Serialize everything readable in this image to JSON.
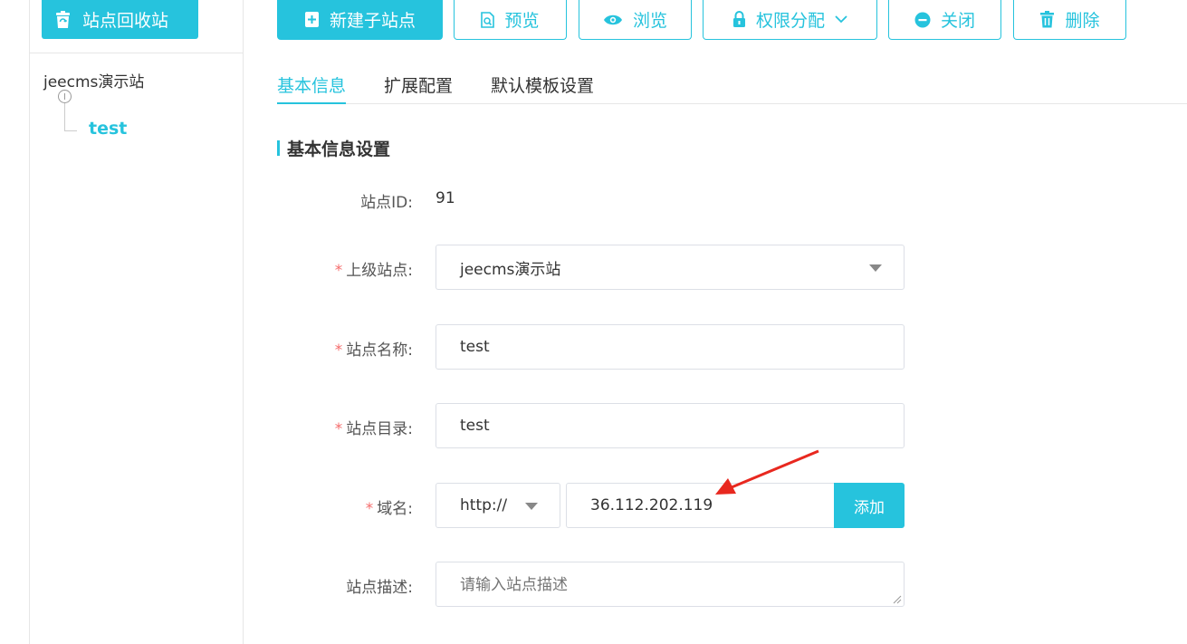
{
  "sidebar": {
    "recycle_label": "站点回收站",
    "tree": {
      "root": "jeecms演示站",
      "child": "test"
    }
  },
  "toolbar": {
    "new_subsite": "新建子站点",
    "preview": "预览",
    "browse": "浏览",
    "permissions": "权限分配",
    "close": "关闭",
    "delete": "删除"
  },
  "tabs": [
    "基本信息",
    "扩展配置",
    "默认模板设置"
  ],
  "section_title": "基本信息设置",
  "form": {
    "site_id_label": "站点ID:",
    "site_id_value": "91",
    "parent_label": "上级站点:",
    "parent_value": "jeecms演示站",
    "name_label": "站点名称:",
    "name_value": "test",
    "dir_label": "站点目录:",
    "dir_value": "test",
    "domain_label": "域名:",
    "protocol_value": "http://",
    "domain_value": "36.112.202.119",
    "add_label": "添加",
    "desc_label": "站点描述:",
    "desc_placeholder": "请输入站点描述",
    "required_mark": "*"
  },
  "colors": {
    "accent": "#26c3dd",
    "required": "#f56c6c",
    "annotation_arrow": "#e8281f"
  }
}
